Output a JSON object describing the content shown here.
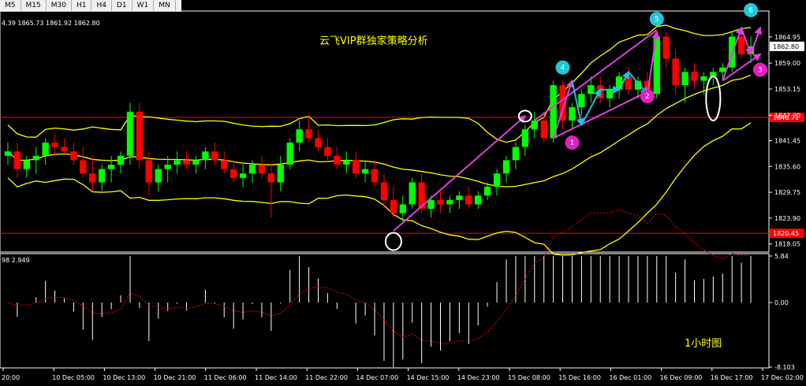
{
  "toolbar": {
    "timeframes": [
      "M5",
      "M15",
      "M30",
      "H1",
      "H4",
      "D1",
      "W1",
      "MN"
    ]
  },
  "main_chart": {
    "ohlc_readout": "4.39 1865.73 1861.92 1862.80",
    "title": "云飞VIP群独家策略分析",
    "price_ticks": [
      "1864.95",
      "1859.00",
      "1853.15",
      "1847.20",
      "1841.45",
      "1835.60",
      "1829.75",
      "1823.90",
      "1818.05"
    ],
    "price_range": [
      1816.2,
      1870.8
    ],
    "current_price_label": "1862.80",
    "h_line_labels": [
      "1846.71",
      "1820.45"
    ]
  },
  "indicator": {
    "readout": "98 2.949",
    "ticks": [
      "5.84",
      "0.00",
      "-8.103"
    ],
    "range": [
      -8.103,
      5.84
    ],
    "timeframe_label": "1小时图"
  },
  "time_labels": [
    "20:00",
    "10 Dec 05:00",
    "10 Dec 13:00",
    "10 Dec 21:00",
    "11 Dec 06:00",
    "11 Dec 14:00",
    "11 Dec 22:00",
    "14 Dec 07:00",
    "14 Dec 15:00",
    "14 Dec 23:00",
    "15 Dec 08:00",
    "15 Dec 16:00",
    "16 Dec 01:00",
    "16 Dec 09:00",
    "16 Dec 17:00",
    "17 Dec 02:00"
  ],
  "markers": {
    "cyan": [
      "4",
      "5",
      "6"
    ],
    "magenta": [
      "1",
      "2",
      "3"
    ]
  },
  "colors": {
    "bull": "#00ff00",
    "bear": "#ff0000",
    "bands": "#ffff00",
    "hline": "#ff0000",
    "trend": "#e040e0",
    "wave": "#20c0e0",
    "hist": "#ffffff",
    "signal": "#ff0000",
    "cyan_marker": "#20c8d8",
    "magenta_marker": "#e020c0"
  },
  "chart_data": {
    "type": "candlestick",
    "symbol_note": "",
    "candles": [
      [
        1838,
        1841,
        1836,
        1839
      ],
      [
        1839,
        1841,
        1833,
        1835
      ],
      [
        1835,
        1838,
        1833,
        1837
      ],
      [
        1837,
        1840,
        1834,
        1838
      ],
      [
        1838,
        1842,
        1836,
        1841
      ],
      [
        1841,
        1843,
        1838,
        1840
      ],
      [
        1840,
        1842,
        1838,
        1839
      ],
      [
        1839,
        1841,
        1836,
        1837
      ],
      [
        1837,
        1840,
        1833,
        1834
      ],
      [
        1834,
        1838,
        1830,
        1832
      ],
      [
        1832,
        1836,
        1830,
        1835
      ],
      [
        1835,
        1838,
        1832,
        1836
      ],
      [
        1836,
        1839,
        1834,
        1838
      ],
      [
        1838,
        1850,
        1836,
        1848
      ],
      [
        1848,
        1850,
        1835,
        1837
      ],
      [
        1837,
        1839,
        1829,
        1832
      ],
      [
        1832,
        1836,
        1830,
        1835
      ],
      [
        1835,
        1838,
        1832,
        1836
      ],
      [
        1836,
        1839,
        1834,
        1837
      ],
      [
        1837,
        1839,
        1835,
        1836
      ],
      [
        1836,
        1838,
        1834,
        1837
      ],
      [
        1837,
        1840,
        1835,
        1839
      ],
      [
        1839,
        1841,
        1836,
        1837
      ],
      [
        1837,
        1839,
        1834,
        1835
      ],
      [
        1835,
        1837,
        1832,
        1833
      ],
      [
        1833,
        1836,
        1831,
        1834
      ],
      [
        1834,
        1837,
        1832,
        1836
      ],
      [
        1836,
        1838,
        1833,
        1834
      ],
      [
        1834,
        1836,
        1824,
        1832
      ],
      [
        1832,
        1838,
        1830,
        1836
      ],
      [
        1836,
        1842,
        1835,
        1841
      ],
      [
        1841,
        1846,
        1839,
        1844
      ],
      [
        1844,
        1847,
        1841,
        1842
      ],
      [
        1842,
        1844,
        1839,
        1840
      ],
      [
        1840,
        1842,
        1837,
        1838
      ],
      [
        1838,
        1840,
        1835,
        1836
      ],
      [
        1836,
        1839,
        1834,
        1837
      ],
      [
        1837,
        1839,
        1833,
        1834
      ],
      [
        1834,
        1837,
        1832,
        1835
      ],
      [
        1835,
        1837,
        1831,
        1832
      ],
      [
        1832,
        1834,
        1826,
        1828
      ],
      [
        1828,
        1831,
        1824,
        1825
      ],
      [
        1825,
        1829,
        1823,
        1827
      ],
      [
        1827,
        1833,
        1826,
        1832
      ],
      [
        1832,
        1834,
        1825,
        1826
      ],
      [
        1826,
        1829,
        1824,
        1828
      ],
      [
        1828,
        1830,
        1825,
        1827
      ],
      [
        1827,
        1829,
        1825,
        1828
      ],
      [
        1828,
        1830,
        1826,
        1829
      ],
      [
        1829,
        1831,
        1826,
        1827
      ],
      [
        1827,
        1830,
        1826,
        1829
      ],
      [
        1829,
        1832,
        1828,
        1831
      ],
      [
        1831,
        1835,
        1829,
        1834
      ],
      [
        1834,
        1838,
        1832,
        1837
      ],
      [
        1837,
        1841,
        1835,
        1840
      ],
      [
        1840,
        1845,
        1838,
        1844
      ],
      [
        1844,
        1848,
        1842,
        1846
      ],
      [
        1846,
        1848,
        1841,
        1842
      ],
      [
        1842,
        1855,
        1841,
        1854
      ],
      [
        1854,
        1855,
        1844,
        1846
      ],
      [
        1846,
        1850,
        1844,
        1849
      ],
      [
        1849,
        1853,
        1847,
        1852
      ],
      [
        1852,
        1856,
        1850,
        1854
      ],
      [
        1854,
        1856,
        1850,
        1851
      ],
      [
        1851,
        1854,
        1849,
        1853
      ],
      [
        1853,
        1857,
        1851,
        1856
      ],
      [
        1856,
        1858,
        1852,
        1853
      ],
      [
        1853,
        1856,
        1851,
        1855
      ],
      [
        1855,
        1857,
        1850,
        1852
      ],
      [
        1852,
        1866,
        1851,
        1865
      ],
      [
        1865,
        1866,
        1858,
        1860
      ],
      [
        1860,
        1862,
        1852,
        1854
      ],
      [
        1854,
        1858,
        1850,
        1857
      ],
      [
        1857,
        1859,
        1853,
        1855
      ],
      [
        1855,
        1857,
        1852,
        1856
      ],
      [
        1856,
        1858,
        1854,
        1857
      ],
      [
        1857,
        1859,
        1855,
        1858
      ],
      [
        1858,
        1866,
        1857,
        1865
      ],
      [
        1865,
        1867,
        1860,
        1861
      ],
      [
        1861,
        1865,
        1859,
        1862.8
      ]
    ],
    "upper_band_label": "",
    "horizontal_lines": [
      1846.71,
      1820.45
    ]
  }
}
